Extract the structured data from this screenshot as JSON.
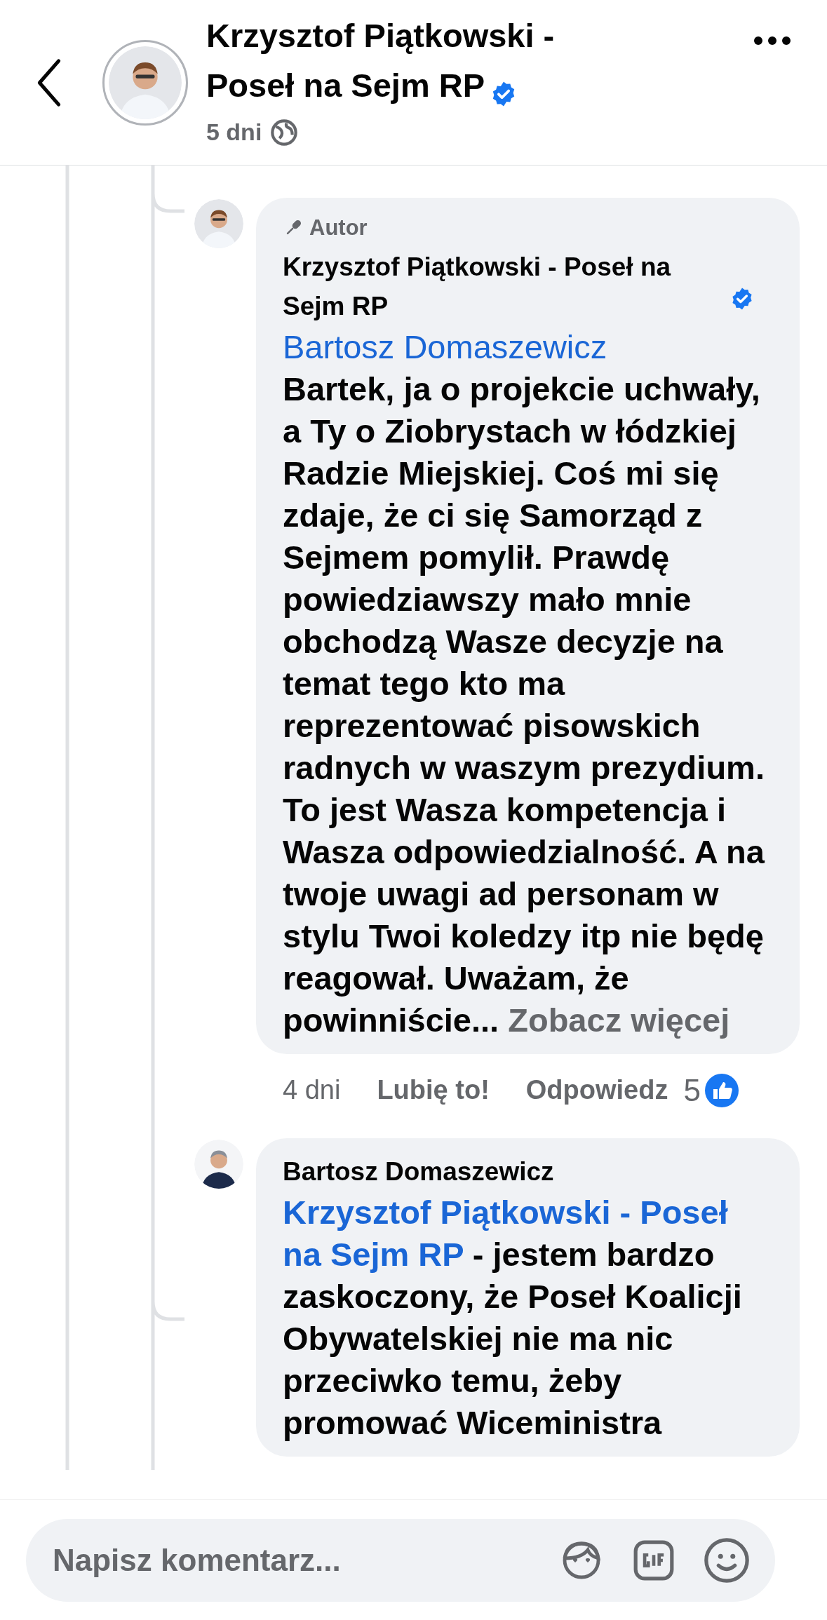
{
  "header": {
    "title": "Krzysztof Piątkowski - Poseł na Sejm RP",
    "verified": true,
    "time": "5 dni"
  },
  "comments": [
    {
      "badge": "Autor",
      "author": "Krzysztof Piątkowski - Poseł na Sejm RP",
      "verified": true,
      "mention": "Bartosz Domaszewicz",
      "kind": "mention_block",
      "text": "Bartek, ja o projekcie uchwały, a Ty o Ziobrystach w łódzkiej Radzie Miejskiej. Coś mi się zdaje, że ci się Samorząd z Sejmem pomylił. Prawdę powiedziawszy mało mnie obchodzą Wasze decyzje na temat tego kto ma reprezentować pisowskich radnych w waszym prezydium. To jest Wasza kompetencja i Wasza odpowiedzialność. A na twoje uwagi ad personam w stylu Twoi koledzy itp nie będę reagował. Uważam, że powinniście...",
      "see_more": "Zobacz więcej",
      "time": "4 dni",
      "like": "Lubię to!",
      "reply": "Odpowiedz",
      "reactions": "5"
    },
    {
      "author": "Bartosz Domaszewicz",
      "verified": false,
      "mention": "Krzysztof Piątkowski - Poseł na Sejm RP",
      "kind": "mention_inline",
      "text": " - jestem bardzo zaskoczony, że Poseł Koalicji Obywatelskiej nie ma nic przeciwko temu, żeby promować Wiceministra"
    }
  ],
  "composer": {
    "placeholder": "Napisz komentarz..."
  }
}
